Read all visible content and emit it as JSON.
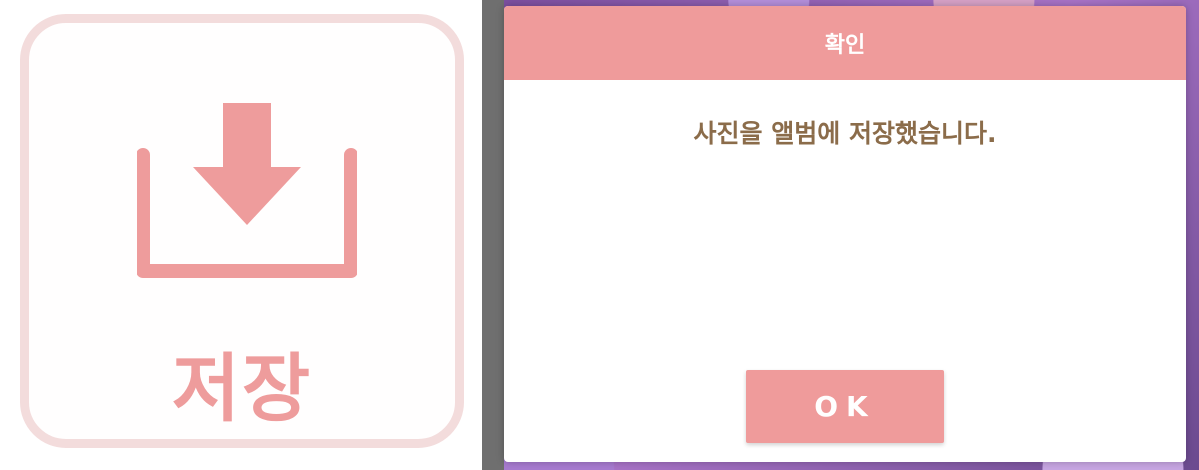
{
  "save_button": {
    "icon": "download-icon",
    "label": "저장",
    "color": "#ee9c9c",
    "border_color": "#f3dcdc"
  },
  "dialog": {
    "title": "확인",
    "message": "사진을 앨범에 저장했습니다.",
    "ok_label": "OK",
    "accent_color": "#ef9b9b",
    "message_color": "#8b6c4a"
  }
}
